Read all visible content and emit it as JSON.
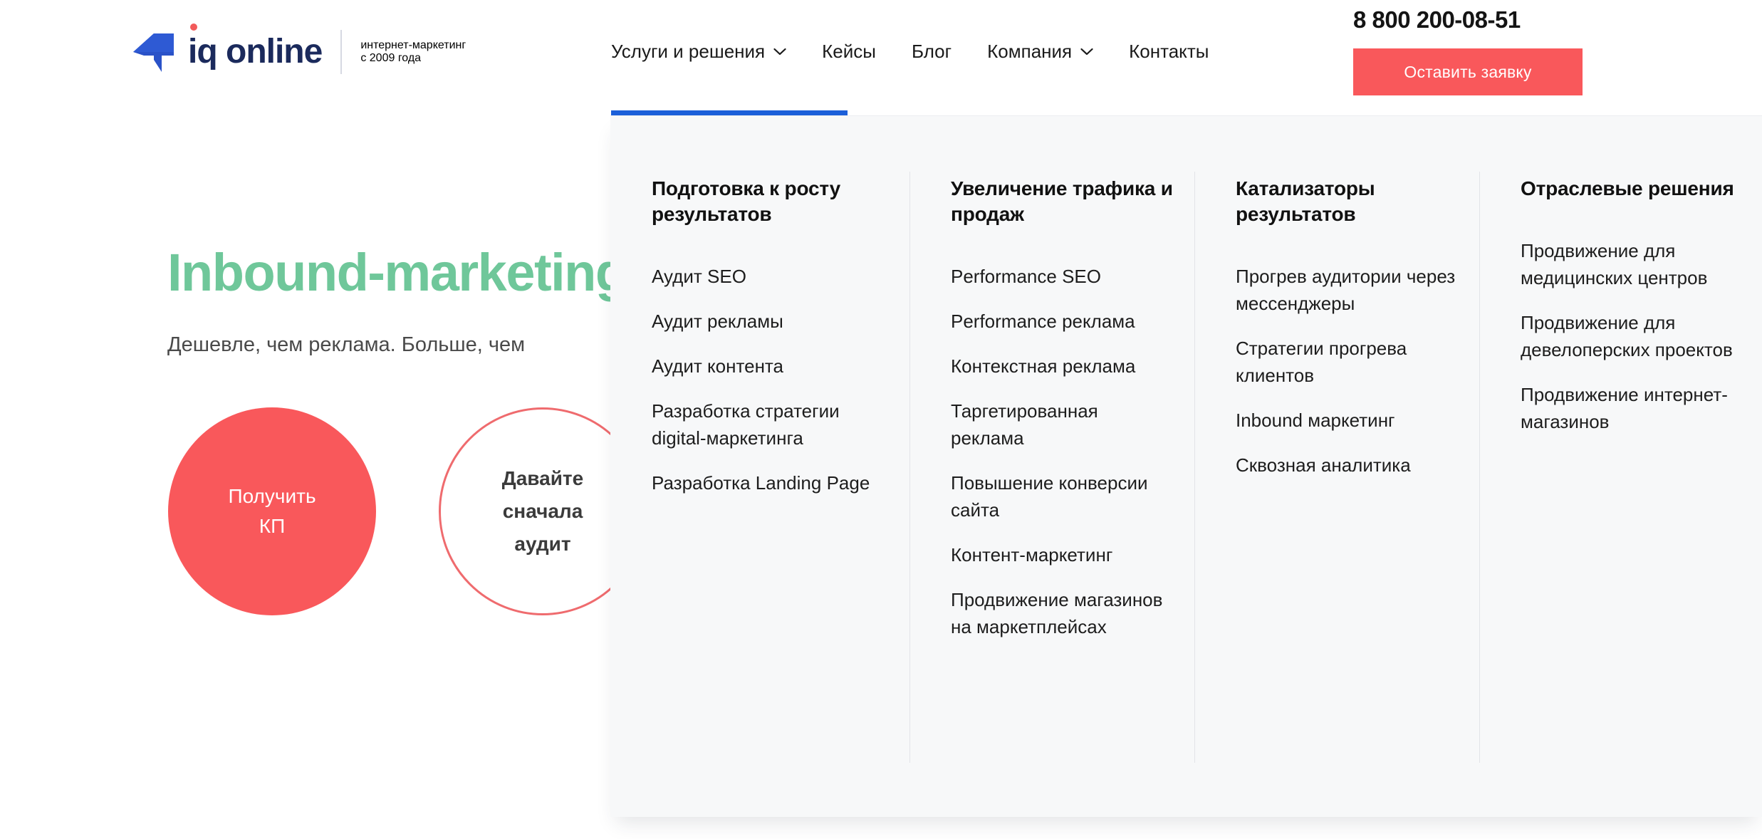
{
  "header": {
    "logo": {
      "wordmark": "iq online",
      "tagline_line1": "интернет-маркетинг",
      "tagline_line2": "с 2009 года"
    },
    "nav": [
      {
        "label": "Услуги и решения",
        "has_chevron": true,
        "active": true
      },
      {
        "label": "Кейсы",
        "has_chevron": false,
        "active": false
      },
      {
        "label": "Блог",
        "has_chevron": false,
        "active": false
      },
      {
        "label": "Компания",
        "has_chevron": true,
        "active": false
      },
      {
        "label": "Контакты",
        "has_chevron": false,
        "active": false
      }
    ],
    "phone": "8 800 200-08-51",
    "cta_label": "Оставить заявку"
  },
  "hero": {
    "title": "Inbound-marketing",
    "subtitle": "Дешевле, чем реклама. Больше, чем",
    "cta_primary": "Получить\nКП",
    "cta_secondary": "Давайте\nсначала\nаудит"
  },
  "mega_menu": {
    "columns": [
      {
        "title": "Подготовка к росту результатов",
        "links": [
          "Аудит SEO",
          "Аудит рекламы",
          "Аудит контента",
          "Разработка стратегии digital-маркетинга",
          "Разработка Landing Page"
        ]
      },
      {
        "title": "Увеличение трафика и продаж",
        "links": [
          "Performance SEO",
          "Performance реклама",
          "Контекстная реклама",
          "Таргетированная реклама",
          "Повышение конверсии сайта",
          "Контент-маркетинг",
          "Продвижение магазинов на маркетплейсах"
        ]
      },
      {
        "title": "Катализаторы результатов",
        "links": [
          "Прогрев аудитории через мессенджеры",
          "Стратегии прогрева клиентов",
          "Inbound маркетинг",
          "Сквозная аналитика"
        ]
      },
      {
        "title": "Отраслевые решения",
        "links": [
          "Продвижение для медицинских центров",
          "Продвижение для девелоперских проектов",
          "Продвижение интернет-магазинов"
        ]
      }
    ]
  },
  "colors": {
    "accent_red": "#f9585b",
    "accent_blue": "#1b5fd9",
    "logo_navy": "#1b2a5c",
    "hero_green": "#6fc79a",
    "panel_bg": "#f7f8f9",
    "divider": "#e2e4e8"
  },
  "icons": {
    "logo_mark": "arrow-logo-icon",
    "chevron": "chevron-down-icon"
  }
}
